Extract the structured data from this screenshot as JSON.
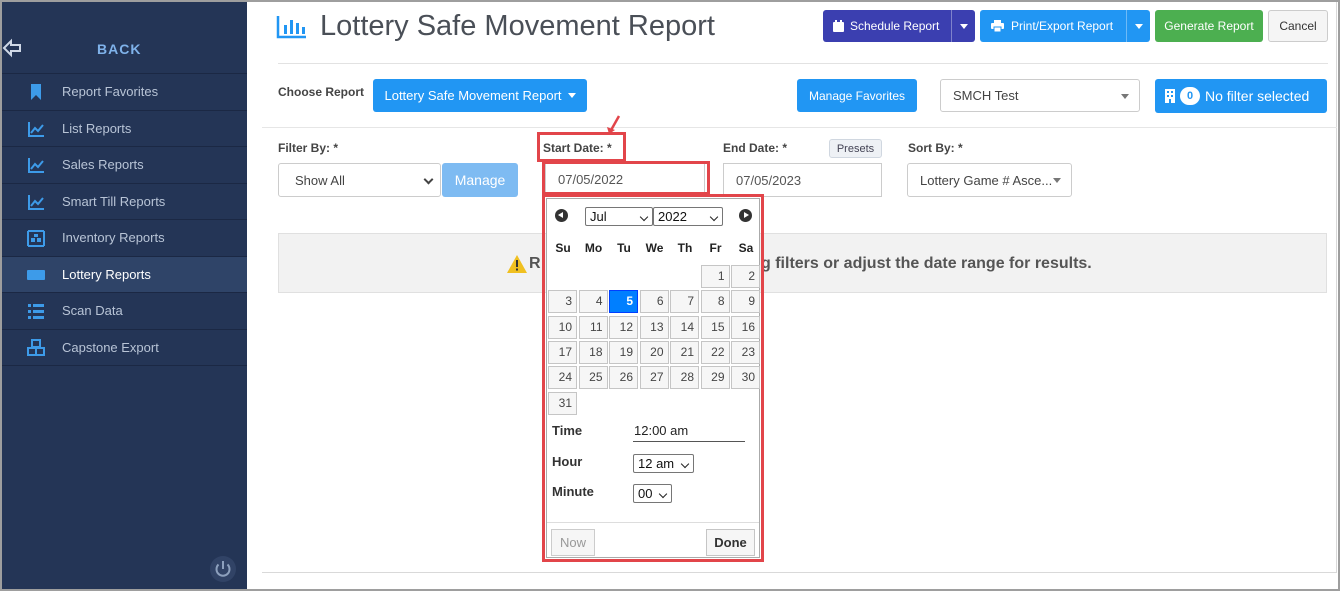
{
  "sidebar": {
    "back_label": "BACK",
    "items": [
      {
        "label": "Report Favorites",
        "icon": "bookmark-icon",
        "active": false
      },
      {
        "label": "List Reports",
        "icon": "line-chart-icon",
        "active": false
      },
      {
        "label": "Sales Reports",
        "icon": "line-chart-icon",
        "active": false
      },
      {
        "label": "Smart Till Reports",
        "icon": "line-chart-icon",
        "active": false
      },
      {
        "label": "Inventory Reports",
        "icon": "warehouse-icon",
        "active": false
      },
      {
        "label": "Lottery Reports",
        "icon": "ticket-icon",
        "active": true
      },
      {
        "label": "Scan Data",
        "icon": "list-icon",
        "active": false
      },
      {
        "label": "Capstone Export",
        "icon": "cubes-icon",
        "active": false
      }
    ]
  },
  "header": {
    "title": "Lottery Safe Movement Report",
    "schedule_label": "Schedule Report",
    "print_label": "Print/Export Report",
    "generate_label": "Generate Report",
    "cancel_label": "Cancel"
  },
  "choose": {
    "label": "Choose Report",
    "report_value": "Lottery Safe Movement Report",
    "manage_favorites_label": "Manage Favorites",
    "store_value": "SMCH Test",
    "filter_count": "0",
    "filter_label": "No filter selected"
  },
  "filters": {
    "filter_by_label": "Filter By: *",
    "filter_by_value": "Show All",
    "manage_label": "Manage",
    "start_label": "Start Date: *",
    "start_value": "07/05/2022",
    "end_label": "End Date: *",
    "end_value": "07/05/2023",
    "presets_label": "Presets",
    "sort_label": "Sort By: *",
    "sort_value": "Lottery Game # Asce..."
  },
  "alert": {
    "text_left": "R",
    "text_right": "g filters or adjust the date range for results."
  },
  "calendar": {
    "month": "Jul",
    "year": "2022",
    "weekdays": [
      "Su",
      "Mo",
      "Tu",
      "We",
      "Th",
      "Fr",
      "Sa"
    ],
    "first_weekday": 5,
    "days_in_month": 31,
    "selected_day": 5,
    "time_label": "Time",
    "time_value": "12:00 am",
    "hour_label": "Hour",
    "hour_value": "12 am",
    "minute_label": "Minute",
    "minute_value": "00",
    "now_label": "Now",
    "done_label": "Done"
  },
  "colors": {
    "sidebar_bg": "#243556",
    "primary": "#2196f3",
    "schedule": "#3b3fb0",
    "generate": "#4caf50",
    "highlight": "#e2454a"
  }
}
